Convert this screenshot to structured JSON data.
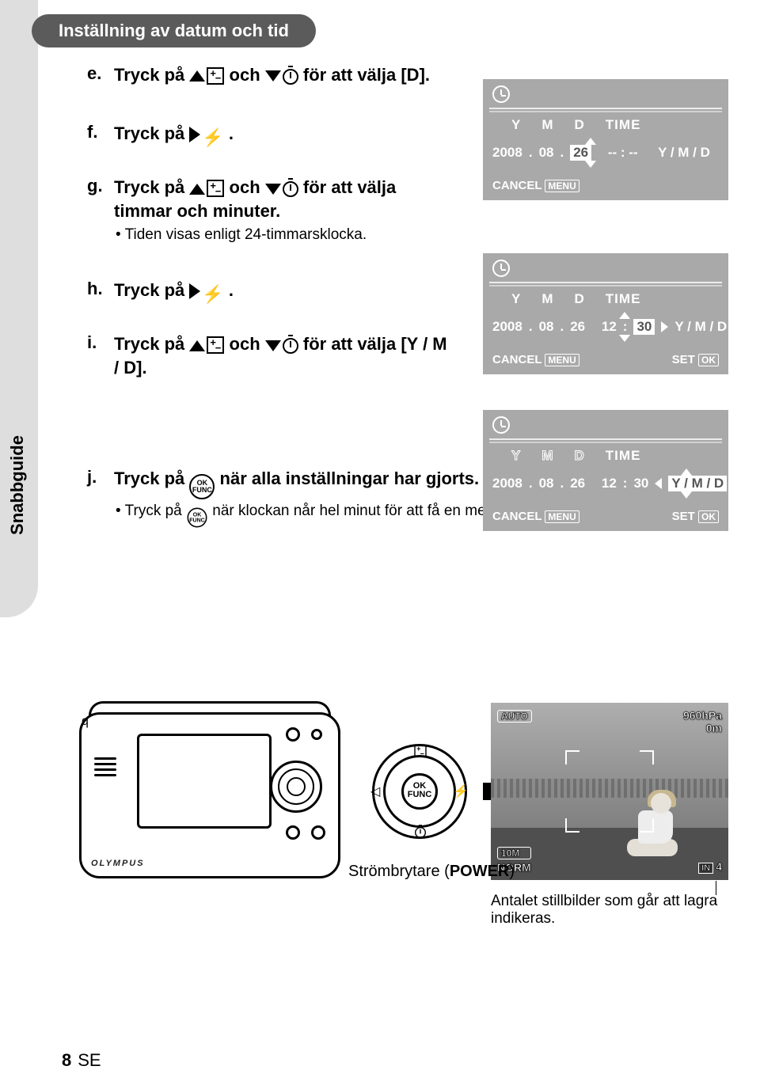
{
  "header": {
    "title": "Inställning av datum och tid"
  },
  "sidebar": {
    "label": "Snabbguide"
  },
  "steps": {
    "e": {
      "letter": "e.",
      "text_pre": "Tryck på ",
      "text_mid": " och ",
      "text_post": " för att välja [D]."
    },
    "f": {
      "letter": "f.",
      "text_pre": "Tryck på ",
      "text_post": "."
    },
    "g": {
      "letter": "g.",
      "text_pre": "Tryck på ",
      "text_mid": " och ",
      "text_post": " för att välja timmar och minuter.",
      "note": "Tiden visas enligt 24-timmarsklocka."
    },
    "h": {
      "letter": "h.",
      "text_pre": "Tryck på ",
      "text_post": "."
    },
    "i": {
      "letter": "i.",
      "text_pre": "Tryck på ",
      "text_mid": " och ",
      "text_post": " för att välja [Y / M / D]."
    },
    "j": {
      "letter": "j.",
      "text_pre": "Tryck på ",
      "text_post": " när alla inställningar har gjorts.",
      "note_pre": "Tryck på ",
      "note_post": " när klockan når hel minut för att få en mer exakt inställning."
    }
  },
  "lcd": {
    "ymdt": {
      "y": "Y",
      "m": "M",
      "d": "D",
      "t": "TIME"
    },
    "cancel": "CANCEL",
    "menu": "MENU",
    "set": "SET",
    "ok": "OK",
    "panel1": {
      "year": "2008",
      "mon": "08",
      "day": "26",
      "time": "-- : --",
      "fmt": "Y / M / D"
    },
    "panel2": {
      "year": "2008",
      "mon": "08",
      "day": "26",
      "hh": "12",
      "mm": "30",
      "fmt": "Y / M / D"
    },
    "panel3": {
      "year": "2008",
      "mon": "08",
      "day": "26",
      "hh": "12",
      "mm": "30",
      "fmt": "Y / M / D"
    }
  },
  "bottom": {
    "dpad": {
      "ok": "OK",
      "func": "FUNC"
    },
    "power_label_pre": "Strömbrytare (",
    "power_label_bold": "POWER",
    "power_label_post": ")",
    "camera_brand": "OLYMPUS",
    "osd": {
      "auto": "AUTO",
      "pressure": "960hPa",
      "alt": "0m",
      "res": "10M",
      "norm": "NORM",
      "in": "IN",
      "count": "4"
    },
    "caption": "Antalet stillbilder som går att lagra indikeras."
  },
  "page": {
    "num": "8",
    "lang": "SE"
  }
}
